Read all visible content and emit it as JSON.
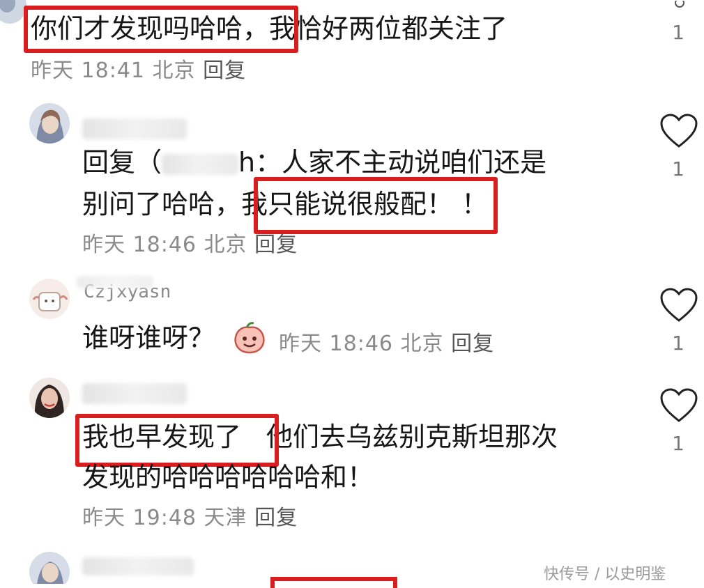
{
  "comments": [
    {
      "text_hl": "你们才发现吗哈哈，",
      "text_rest": "我恰好两位都关注了",
      "meta": "昨天 18:41 北京",
      "reply": "回复",
      "like_count": "1"
    },
    {
      "line1_prefix": "回复（",
      "line1_suffix": "h：人家不主动说咱们还是",
      "line2_prefix": "别问了哈哈，",
      "line2_hl": "我只能说很般配！",
      "line2_suffix": "！",
      "meta": "昨天 18:46 北京",
      "reply": "回复",
      "like_count": "1"
    },
    {
      "username": "Czjxyasn",
      "text": "谁呀谁呀？",
      "meta": "昨天 18:46 北京",
      "reply": "回复",
      "like_count": "1"
    },
    {
      "text_hl": "我也早发现了",
      "text_rest": "他们去乌兹别克斯坦那次",
      "line2": "发现的哈哈哈哈哈哈和！",
      "meta": "昨天 19:48 天津",
      "reply": "回复",
      "like_count": "1"
    }
  ],
  "watermark": "快传号 / 以史明鉴",
  "icons": {
    "like": "heart-outline-icon",
    "emoji": "peach-face-emoji-icon"
  },
  "colors": {
    "highlight_box": "#d81e1e",
    "meta_text": "#8a8a8a",
    "body_text": "#161616"
  }
}
